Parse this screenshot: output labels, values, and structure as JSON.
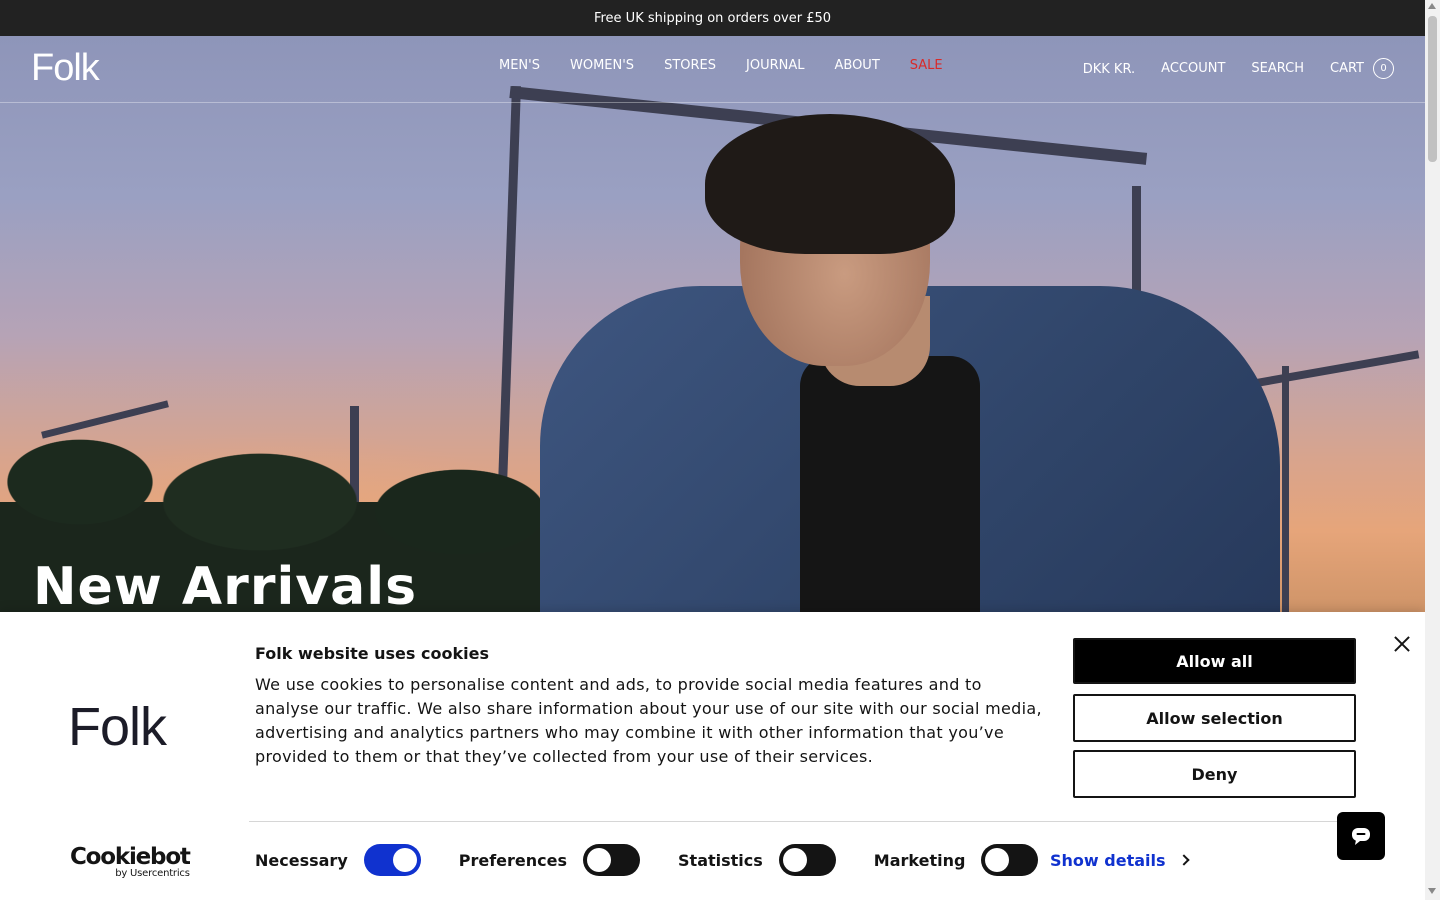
{
  "announcement": {
    "text": "Free UK shipping on orders over £50"
  },
  "header": {
    "logo": "Folk",
    "nav": [
      "MEN'S",
      "WOMEN'S",
      "STORES",
      "JOURNAL",
      "ABOUT",
      "SALE"
    ],
    "currency": "DKK KR.",
    "account": "ACCOUNT",
    "search": "SEARCH",
    "cart": "CART",
    "cart_count": "0"
  },
  "hero": {
    "title": "New Arrivals"
  },
  "cookie": {
    "logo": "Folk",
    "title": "Folk website uses cookies",
    "body": "We use cookies to personalise content and ads, to provide social media features and to analyse our traffic. We also share information about your use of our site with our social media, advertising and analytics partners who may combine it with other information that you’ve provided to them or that they’ve collected from your use of their services.",
    "buttons": {
      "allow_all": "Allow all",
      "allow_selection": "Allow selection",
      "deny": "Deny"
    },
    "toggles": [
      {
        "label": "Necessary",
        "state": "on"
      },
      {
        "label": "Preferences",
        "state": "off"
      },
      {
        "label": "Statistics",
        "state": "off"
      },
      {
        "label": "Marketing",
        "state": "off"
      }
    ],
    "show_details": "Show details",
    "brand": {
      "name": "Cookiebot",
      "by": "by Usercentrics"
    }
  },
  "colors": {
    "announcement_bg": "#222222",
    "sale": "#d82a2a",
    "toggle_on": "#1032cf",
    "link": "#1032cf"
  },
  "icons": {
    "close": "close-icon",
    "chevron": "chevron-right-icon",
    "chat": "chat-icon",
    "cart_badge": "cart-count-badge"
  }
}
